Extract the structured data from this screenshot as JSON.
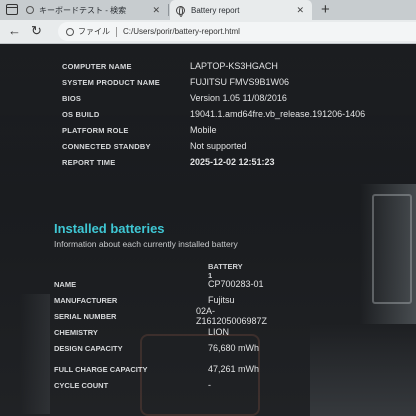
{
  "browser": {
    "tabs": [
      {
        "label": "キーボードテスト - 検索",
        "active": false
      },
      {
        "label": "Battery report",
        "active": true
      }
    ],
    "new_tab_symbol": "+",
    "close_symbol": "✕",
    "back_symbol": "←",
    "reload_symbol": "↻",
    "url_prefix": "ファイル",
    "url": "C:/Users/porir/battery-report.html"
  },
  "system_info": [
    {
      "label": "COMPUTER NAME",
      "value": "LAPTOP-KS3HGACH"
    },
    {
      "label": "SYSTEM PRODUCT NAME",
      "value": "FUJITSU FMVS9B1W06"
    },
    {
      "label": "BIOS",
      "value": "Version 1.05 11/08/2016"
    },
    {
      "label": "OS BUILD",
      "value": "19041.1.amd64fre.vb_release.191206-1406"
    },
    {
      "label": "PLATFORM ROLE",
      "value": "Mobile"
    },
    {
      "label": "CONNECTED STANDBY",
      "value": "Not supported"
    },
    {
      "label": "REPORT TIME",
      "value": "2025-12-02   12:51:23"
    }
  ],
  "installed_batteries": {
    "title": "Installed batteries",
    "subtitle": "Information about each currently installed battery",
    "column_header": "BATTERY 1",
    "rows": [
      {
        "label": "NAME",
        "value": "CP700283-01"
      },
      {
        "label": "MANUFACTURER",
        "value": "Fujitsu"
      },
      {
        "label": "SERIAL NUMBER",
        "value": "02A-Z161205006987Z"
      },
      {
        "label": "CHEMISTRY",
        "value": "LION"
      },
      {
        "label": "DESIGN CAPACITY",
        "value": "76,680 mWh"
      },
      {
        "label": "FULL CHARGE CAPACITY",
        "value": "47,261 mWh"
      },
      {
        "label": "CYCLE COUNT",
        "value": "-"
      }
    ]
  },
  "colors": {
    "accent": "#3fc7d4",
    "background": "#1a1c1f",
    "chrome": "#e8ebec"
  }
}
